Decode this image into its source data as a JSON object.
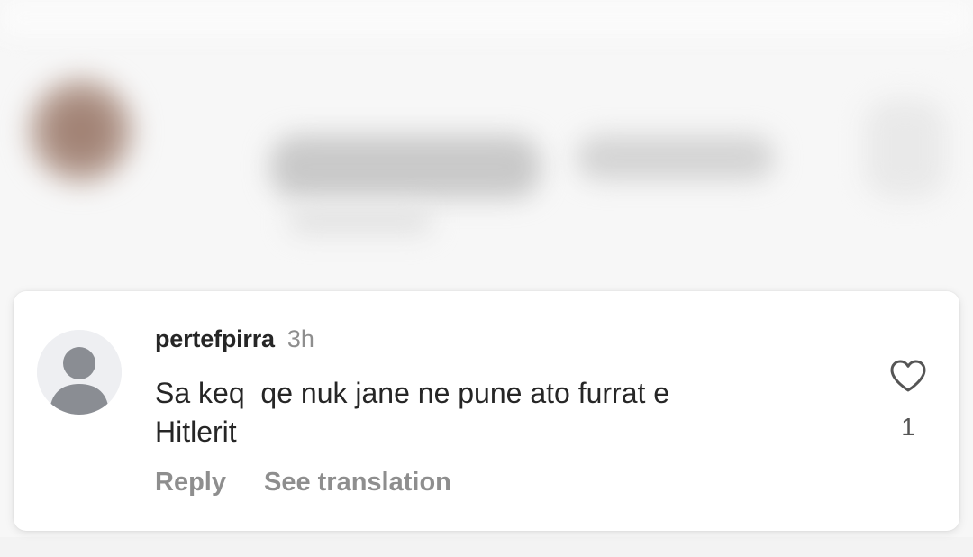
{
  "background": {
    "blurred_post": true
  },
  "comment": {
    "username": "pertefpirra",
    "timestamp": "3h",
    "text": "Sa keq  qe nuk jane ne pune ato furrat e\nHitlerit",
    "like_count": "1",
    "actions": {
      "reply_label": "Reply",
      "translate_label": "See translation"
    },
    "avatar_icon": "default-user-icon",
    "like_icon": "heart-outline-icon"
  },
  "colors": {
    "username": "#262626",
    "secondary": "#8e8e8e",
    "avatar_bg": "#eeeff2",
    "avatar_fg": "#8a8d93"
  }
}
